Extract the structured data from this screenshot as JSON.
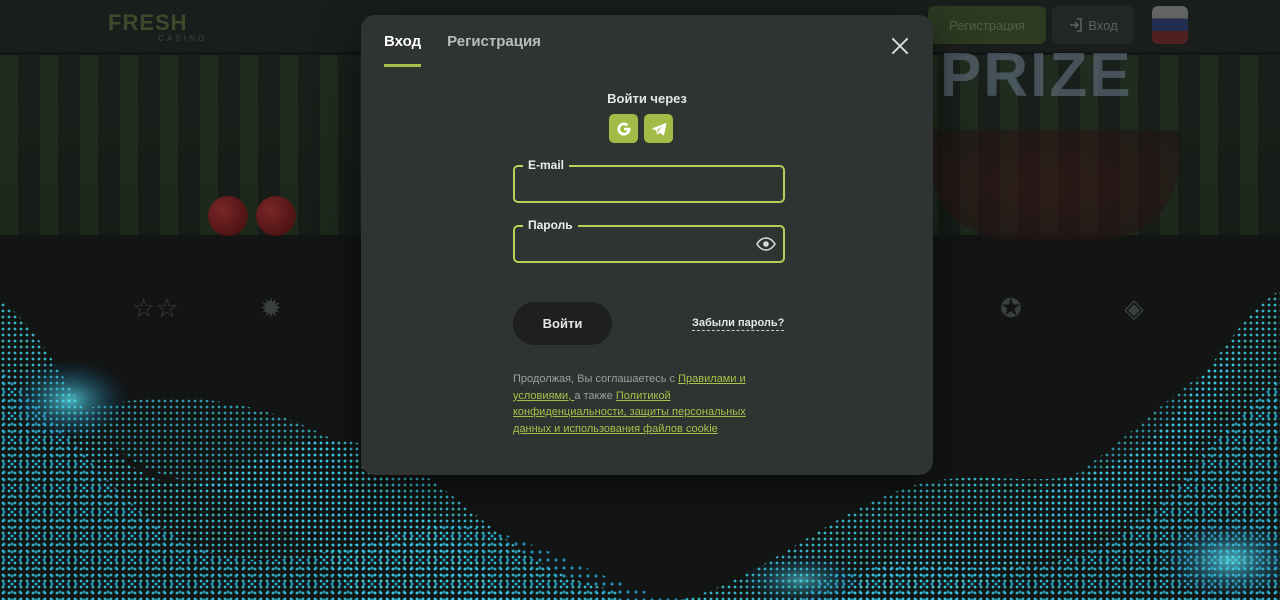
{
  "background": {
    "logo": "FRESH",
    "logo_sub": "CASINO",
    "header_register": "Регистрация",
    "header_login": "Вход",
    "prize_text": "PRIZE"
  },
  "modal": {
    "tabs": [
      {
        "label": "Вход",
        "active": true
      },
      {
        "label": "Регистрация",
        "active": false
      }
    ],
    "social_title": "Войти через",
    "social_buttons": [
      {
        "icon": "google-icon"
      },
      {
        "icon": "telegram-icon"
      }
    ],
    "email": {
      "label": "E-mail",
      "value": ""
    },
    "password": {
      "label": "Пароль",
      "value": ""
    },
    "login_label": "Войти",
    "forgot_label": "Забыли пароль?",
    "legal": {
      "prefix": "Продолжая, Вы соглашаетесь с ",
      "terms_link": "Правилами и условиями, ",
      "middle": "а также ",
      "privacy_link": "Политикой конфиденциальности, защиты персональных данных и использования файлов cookie"
    }
  },
  "colors": {
    "accent": "#a7c04a",
    "modal_bg": "#2f3331",
    "page_bg": "#121514"
  }
}
